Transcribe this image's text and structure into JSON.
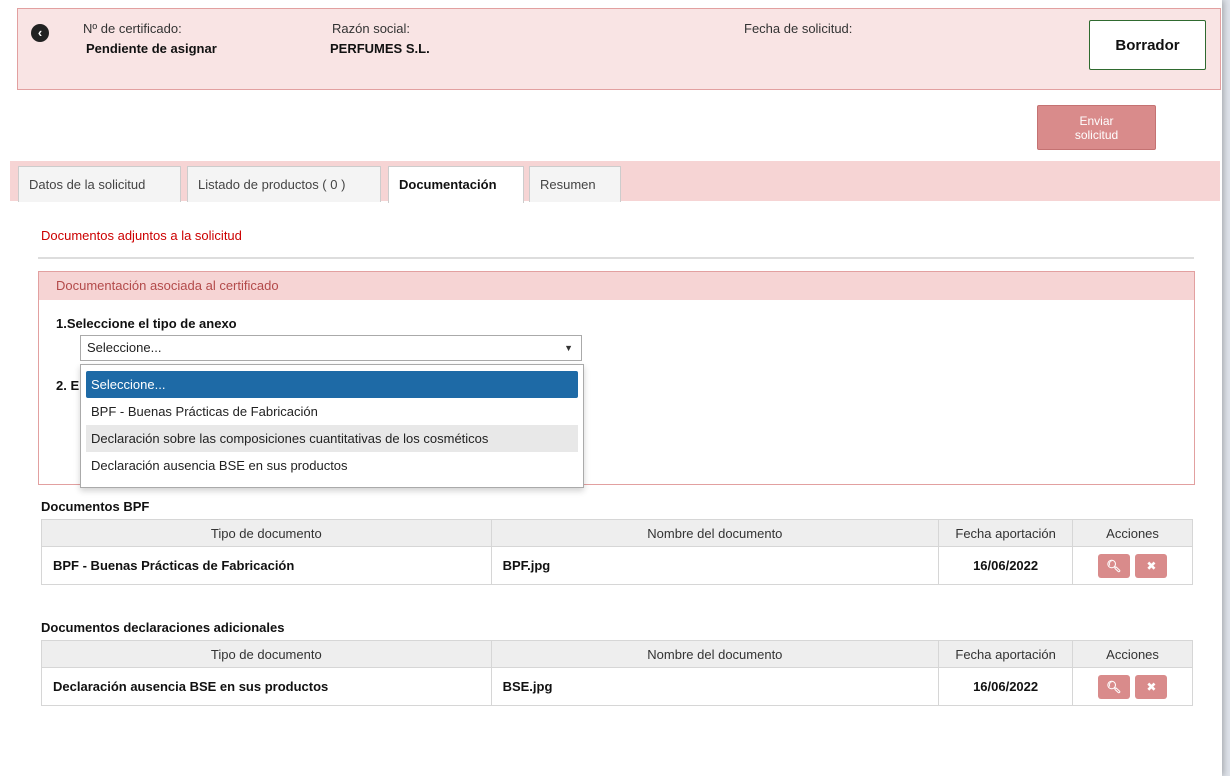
{
  "header": {
    "back_icon": "chevron-left-icon",
    "cert_label": "Nº de certificado:",
    "cert_value": "Pendiente de asignar",
    "company_label": "Razón social:",
    "company_value": "PERFUMES S.L.",
    "date_label": "Fecha de solicitud:",
    "status_button": "Borrador"
  },
  "actions": {
    "send_line1": "Enviar",
    "send_line2": "solicitud"
  },
  "tabs": [
    {
      "label": "Datos de la solicitud",
      "active": false
    },
    {
      "label": "Listado de productos ( 0 )",
      "active": false
    },
    {
      "label": "Documentación",
      "active": true
    },
    {
      "label": "Resumen",
      "active": false
    }
  ],
  "section": {
    "title": "Documentos adjuntos a la solicitud"
  },
  "panel": {
    "header": "Documentación asociada al certificado",
    "step1_label": "1.Seleccione el tipo de anexo",
    "step2_label_visible": "2. E",
    "select_value": "Seleccione...",
    "dropdown_options": [
      "Seleccione...",
      "BPF - Buenas Prácticas de Fabricación",
      "Declaración sobre las composiciones cuantitativas de los cosméticos",
      "Declaración ausencia BSE en sus productos"
    ]
  },
  "table_columns": [
    "Tipo de documento",
    "Nombre del documento",
    "Fecha aportación",
    "Acciones"
  ],
  "bpf": {
    "title": "Documentos BPF",
    "rows": [
      {
        "tipo": "BPF - Buenas Prácticas de Fabricación",
        "nombre": "BPF.jpg",
        "fecha": "16/06/2022"
      }
    ]
  },
  "additional": {
    "title": "Documentos declaraciones adicionales",
    "rows": [
      {
        "tipo": "Declaración ausencia BSE en sus productos",
        "nombre": "BSE.jpg",
        "fecha": "16/06/2022"
      }
    ]
  },
  "icons": {
    "view": "search-icon",
    "delete": "close-icon"
  },
  "colors": {
    "header_bg": "#f9e4e4",
    "accent": "#d98b8b",
    "section_title": "#cc0000",
    "selected_option": "#1e6aa6"
  }
}
